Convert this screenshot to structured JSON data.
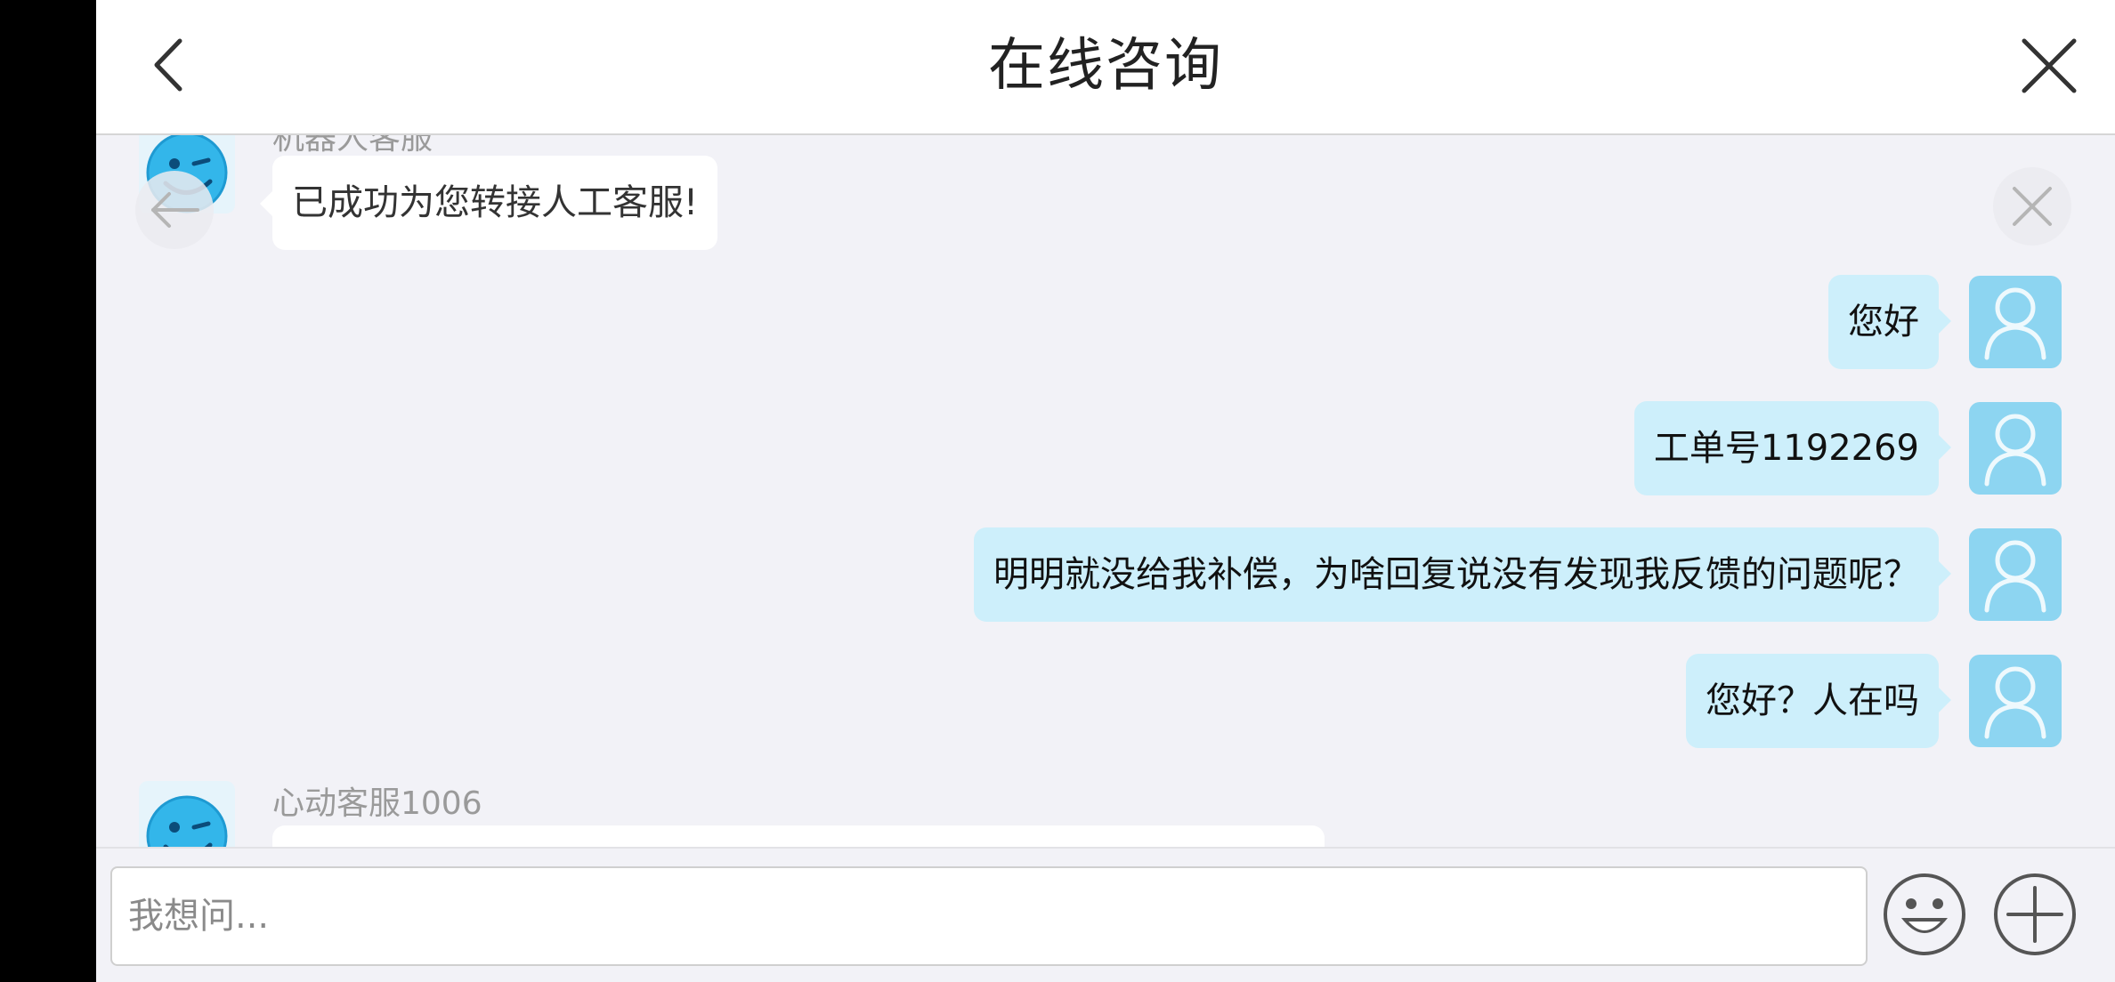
{
  "header": {
    "title": "在线咨询",
    "back_icon": "chevron-left-icon",
    "close_icon": "close-icon"
  },
  "messages": [
    {
      "from": "agent",
      "sender": "机器人客服",
      "text": "已成功为您转接人工客服!"
    },
    {
      "from": "user",
      "text": "您好"
    },
    {
      "from": "user",
      "text": "工单号1192269"
    },
    {
      "from": "user",
      "text": "明明就没给我补偿，为啥回复说没有发现我反馈的问题呢？"
    },
    {
      "from": "user",
      "text": "您好？人在吗"
    },
    {
      "from": "agent",
      "sender": "心动客服1006",
      "text": ""
    }
  ],
  "input": {
    "placeholder": "我想问...",
    "value": ""
  },
  "buttons": {
    "emoji_icon": "smiley-icon",
    "more_icon": "plus-circle-icon"
  },
  "colors": {
    "user_bubble": "#cdeffb",
    "agent_bubble": "#ffffff",
    "user_avatar": "#8dd5f1",
    "chat_background": "#f2f2f7"
  }
}
